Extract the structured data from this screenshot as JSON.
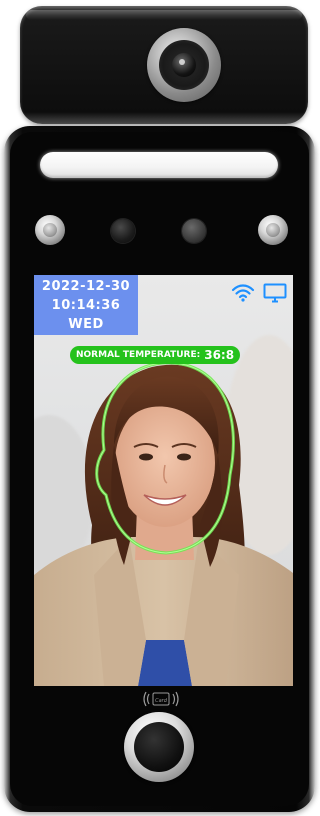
{
  "device": {
    "type": "face-recognition-terminal"
  },
  "screen": {
    "datetime": {
      "date": "2022-12-30",
      "time": "10:14:36",
      "weekday": "WED"
    },
    "status_icons": [
      "wifi-icon",
      "monitor-icon"
    ],
    "temperature": {
      "label": "NORMAL TEMPERATURE:",
      "value": "36:8",
      "status_color": "#25c21c"
    },
    "face_outline_color": "#6ee84f",
    "datetime_bg_color": "#6c90ee",
    "icon_color": "#1e90ff"
  },
  "card_reader": {
    "label": "Card"
  }
}
